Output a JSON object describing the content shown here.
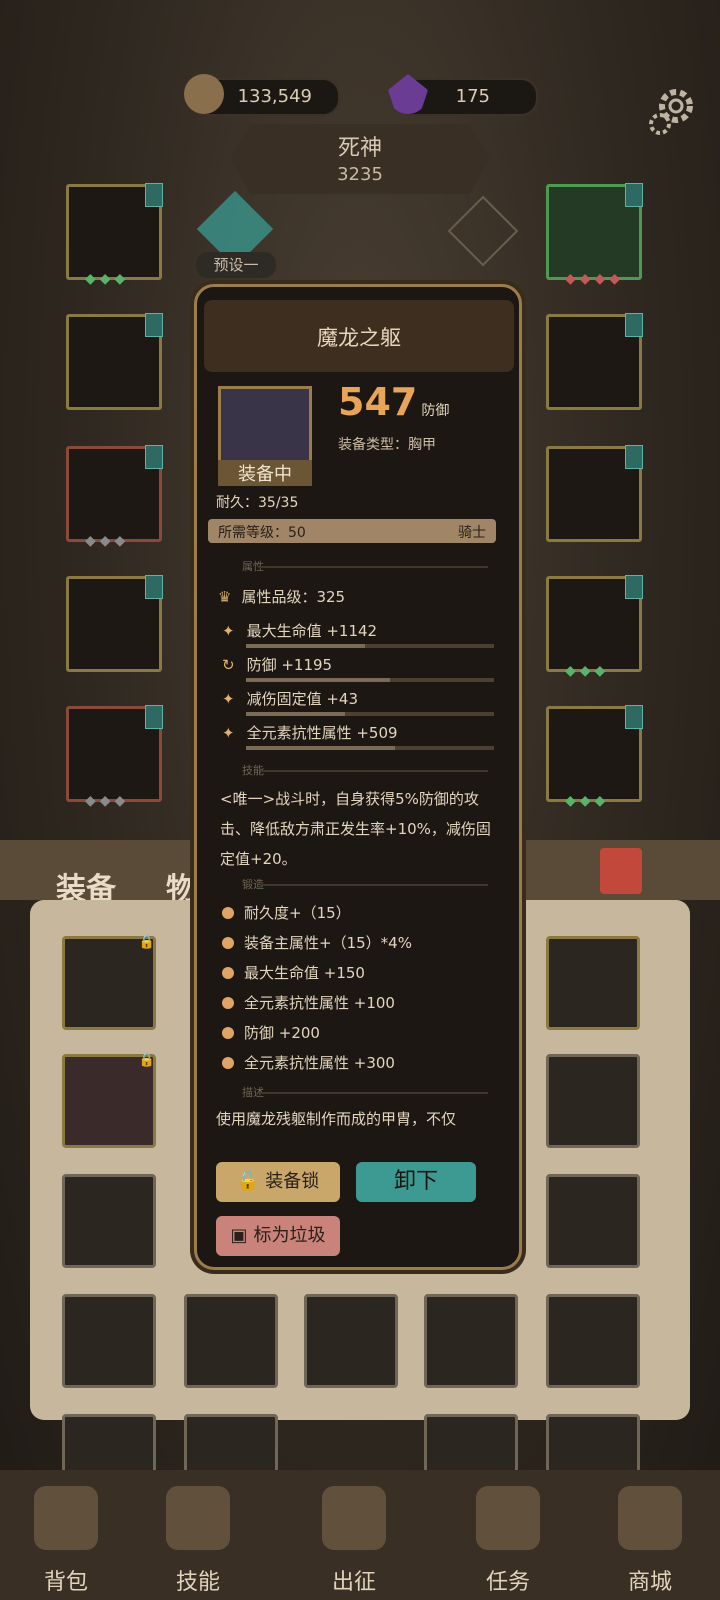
{
  "currency": {
    "gold": "133,549",
    "gems": "175"
  },
  "character": {
    "name": "死神",
    "power": "3235",
    "preset": "预设一"
  },
  "bag_tabs": [
    "装备",
    "物品"
  ],
  "item": {
    "name": "魔龙之躯",
    "defense_value": "547",
    "defense_label": "防御",
    "type_label": "装备类型：胸甲",
    "equipped_label": "装备中",
    "durability": "耐久：35/35",
    "req_level": "所需等级：50",
    "req_class": "骑士",
    "section_attr": "属性",
    "attr_grade": "属性品级：325",
    "attrs": [
      "最大生命值 +1142",
      "防御 +1195",
      "减伤固定值 +43",
      "全元素抗性属性 +509"
    ],
    "attr_fill": [
      0.48,
      0.58,
      0.4,
      0.6
    ],
    "section_skill": "技能",
    "skill_text": "<唯一>战斗时，自身获得5%防御的攻击、降低敌方肃正发生率+10%，减伤固定值+20。",
    "section_forge": "锻造",
    "forge": [
      "耐久度+（15）",
      "装备主属性+（15）*4%",
      "最大生命值 +150",
      "全元素抗性属性 +100",
      "防御 +200",
      "全元素抗性属性 +300"
    ],
    "section_desc": "描述",
    "desc_text": "使用魔龙残躯制作而成的甲胄，不仅"
  },
  "buttons": {
    "lock": "装备锁",
    "unequip": "卸下",
    "junk": "标为垃圾"
  },
  "nav": [
    "背包",
    "技能",
    "出征",
    "任务",
    "商城"
  ],
  "colors": {
    "accent": "#e8a55a",
    "panel": "#1c1713",
    "frame": "#9a7d4a",
    "teal": "#3a8f86"
  }
}
